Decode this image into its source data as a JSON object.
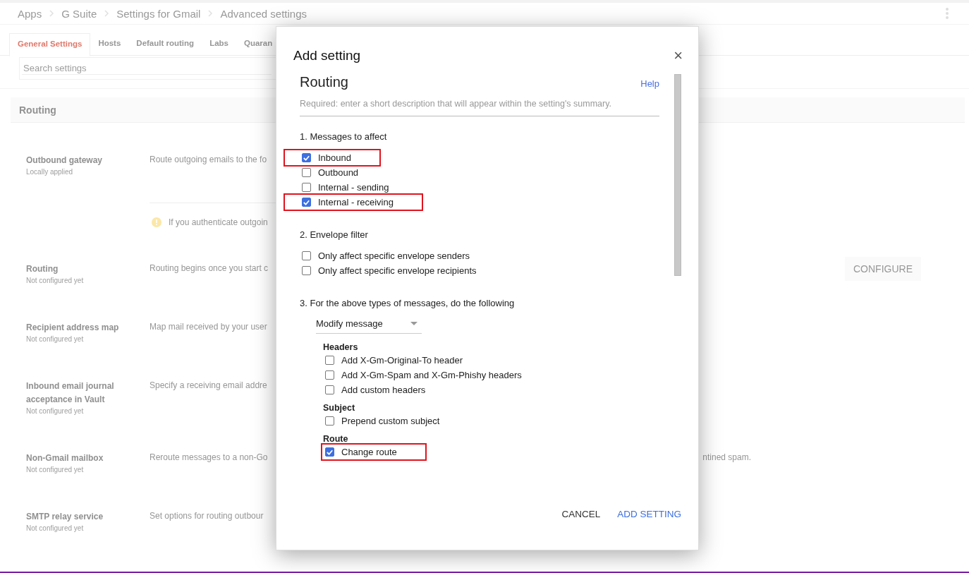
{
  "breadcrumb": [
    "Apps",
    "G Suite",
    "Settings for Gmail",
    "Advanced settings"
  ],
  "tabs": [
    {
      "label": "General Settings",
      "selected": true
    },
    {
      "label": "Hosts",
      "selected": false
    },
    {
      "label": "Default routing",
      "selected": false
    },
    {
      "label": "Labs",
      "selected": false
    },
    {
      "label": "Quaran",
      "selected": false
    }
  ],
  "search": {
    "placeholder": "Search settings"
  },
  "section": {
    "title": "Routing"
  },
  "settings": [
    {
      "name": "Outbound gateway",
      "status": "Locally applied",
      "description": "Route outgoing emails to the fo",
      "note": "If you authenticate outgoin"
    },
    {
      "name": "Routing",
      "status": "Not configured yet",
      "description": "Routing begins once you start c",
      "button": "CONFIGURE"
    },
    {
      "name": "Recipient address map",
      "status": "Not configured yet",
      "description": "Map mail received by your user"
    },
    {
      "name": "Inbound email journal acceptance in Vault",
      "status": "Not configured yet",
      "description": "Specify a receiving email addre"
    },
    {
      "name": "Non-Gmail mailbox",
      "status": "Not configured yet",
      "description": "Reroute messages to a non-Go",
      "description_tail": "ntined spam."
    },
    {
      "name": "SMTP relay service",
      "status": "Not configured yet",
      "description": "Set options for routing outbour"
    }
  ],
  "dialog": {
    "title": "Add setting",
    "close": "×",
    "heading": "Routing",
    "help": "Help",
    "description": {
      "placeholder": "Required: enter a short description that will appear within the setting's summary."
    },
    "sections": [
      {
        "title": "1. Messages to affect",
        "options": [
          {
            "label": "Inbound",
            "checked": true,
            "highlighted": true
          },
          {
            "label": "Outbound",
            "checked": false,
            "highlighted": false
          },
          {
            "label": "Internal - sending",
            "checked": false,
            "highlighted": false
          },
          {
            "label": "Internal - receiving",
            "checked": true,
            "highlighted": true
          }
        ]
      },
      {
        "title": "2. Envelope filter",
        "options": [
          {
            "label": "Only affect specific envelope senders",
            "checked": false,
            "highlighted": false
          },
          {
            "label": "Only affect specific envelope recipients",
            "checked": false,
            "highlighted": false
          }
        ]
      },
      {
        "title": "3. For the above types of messages, do the following",
        "dropdown": "Modify message",
        "groups": [
          {
            "title": "Headers",
            "options": [
              {
                "label": "Add X-Gm-Original-To header",
                "checked": false,
                "highlighted": false
              },
              {
                "label": "Add X-Gm-Spam and X-Gm-Phishy headers",
                "checked": false,
                "highlighted": false
              },
              {
                "label": "Add custom headers",
                "checked": false,
                "highlighted": false
              }
            ]
          },
          {
            "title": "Subject",
            "options": [
              {
                "label": "Prepend custom subject",
                "checked": false,
                "highlighted": false
              }
            ]
          },
          {
            "title": "Route",
            "options": [
              {
                "label": "Change route",
                "checked": true,
                "highlighted": true
              }
            ]
          }
        ]
      }
    ],
    "buttons": [
      {
        "label": "CANCEL",
        "kind": "text"
      },
      {
        "label": "ADD SETTING",
        "kind": "primary"
      }
    ]
  }
}
